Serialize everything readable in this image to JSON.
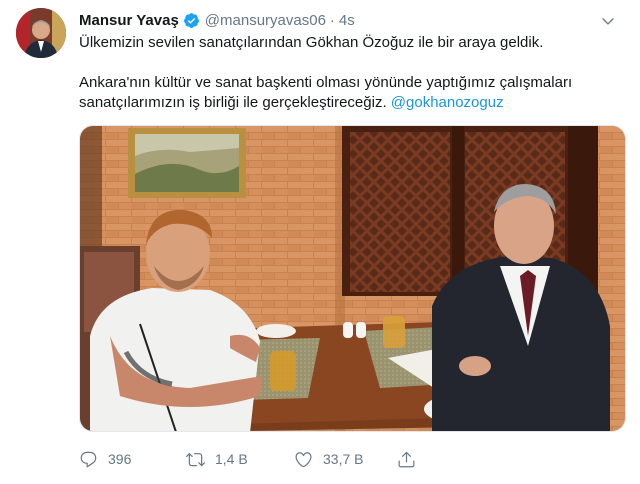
{
  "tweet": {
    "display_name": "Mansur Yavaş",
    "handle": "@mansuryavas06",
    "separator": "·",
    "time": "4s",
    "line1": "Ülkemizin sevilen sanatçılarından Gökhan Özoğuz ile bir araya geldik.",
    "line2": "Ankara'nın kültür ve sanat başkenti olması yönünde yaptığımız çalışmaları",
    "line3_prefix": "sanatçılarımızın iş birliği ile gerçekleştireceğiz. ",
    "mention": "@gokhanozoguz"
  },
  "actions": {
    "reply_count": "396",
    "retweet_count": "1,4 B",
    "like_count": "33,7 B"
  },
  "icons": {
    "verified": "verified-badge-icon",
    "caret": "chevron-down-icon",
    "reply": "reply-bubble-icon",
    "retweet": "retweet-icon",
    "like": "heart-icon",
    "share": "share-upload-icon"
  },
  "colors": {
    "link": "#1b95e0",
    "muted": "#657786",
    "text": "#14171a",
    "verified": "#1da1f2"
  }
}
